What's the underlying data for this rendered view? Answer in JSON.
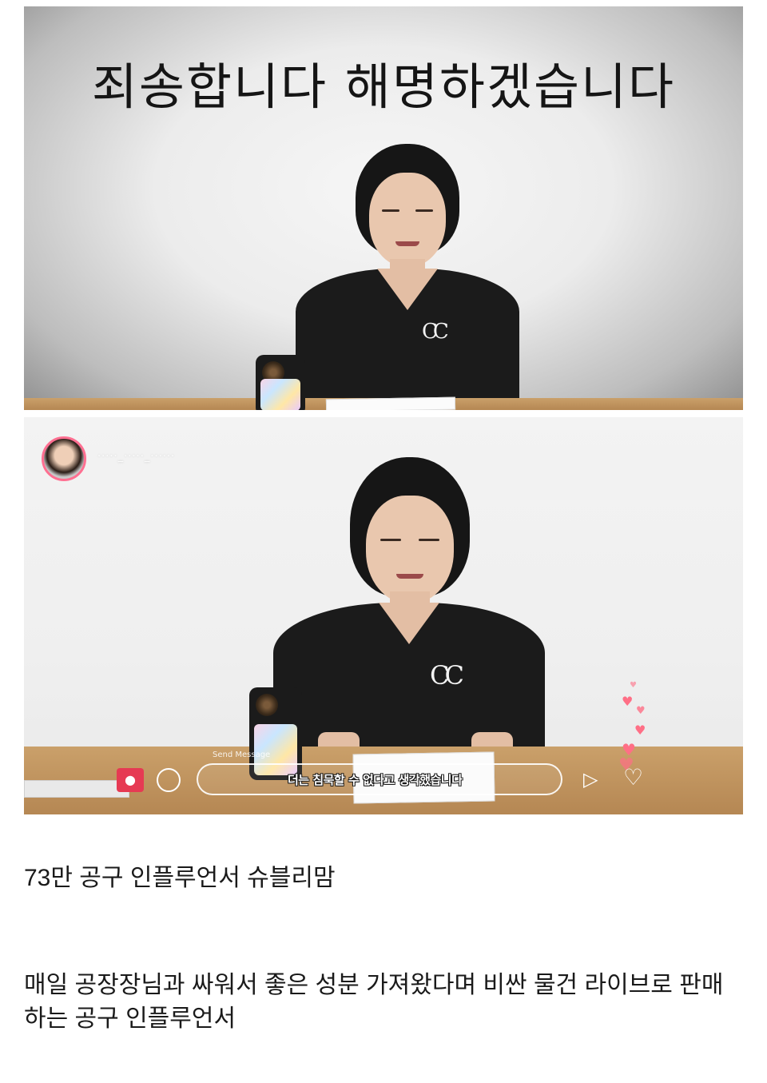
{
  "image_top": {
    "headline": "죄송합니다 해명하겠습니다"
  },
  "image_bottom": {
    "account_name": "·····_·····_······",
    "message_placeholder": "Send Message",
    "subtitle": "더는 침묵할 수 없다고 생각했습니다",
    "icons": [
      "shop-icon",
      "chat-icon",
      "send-icon",
      "heart-icon"
    ]
  },
  "article": {
    "line1": "73만 공구 인플루언서 슈블리맘",
    "paragraph": "매일 공장장님과 싸워서 좋은 성분 가져왔다며 비싼 물건 라이브로 판매하는 공구 인플루언서"
  },
  "colors": {
    "live_red": "#e63a53",
    "heart_pink": "#ff6f86",
    "text": "#1a1a1a"
  }
}
